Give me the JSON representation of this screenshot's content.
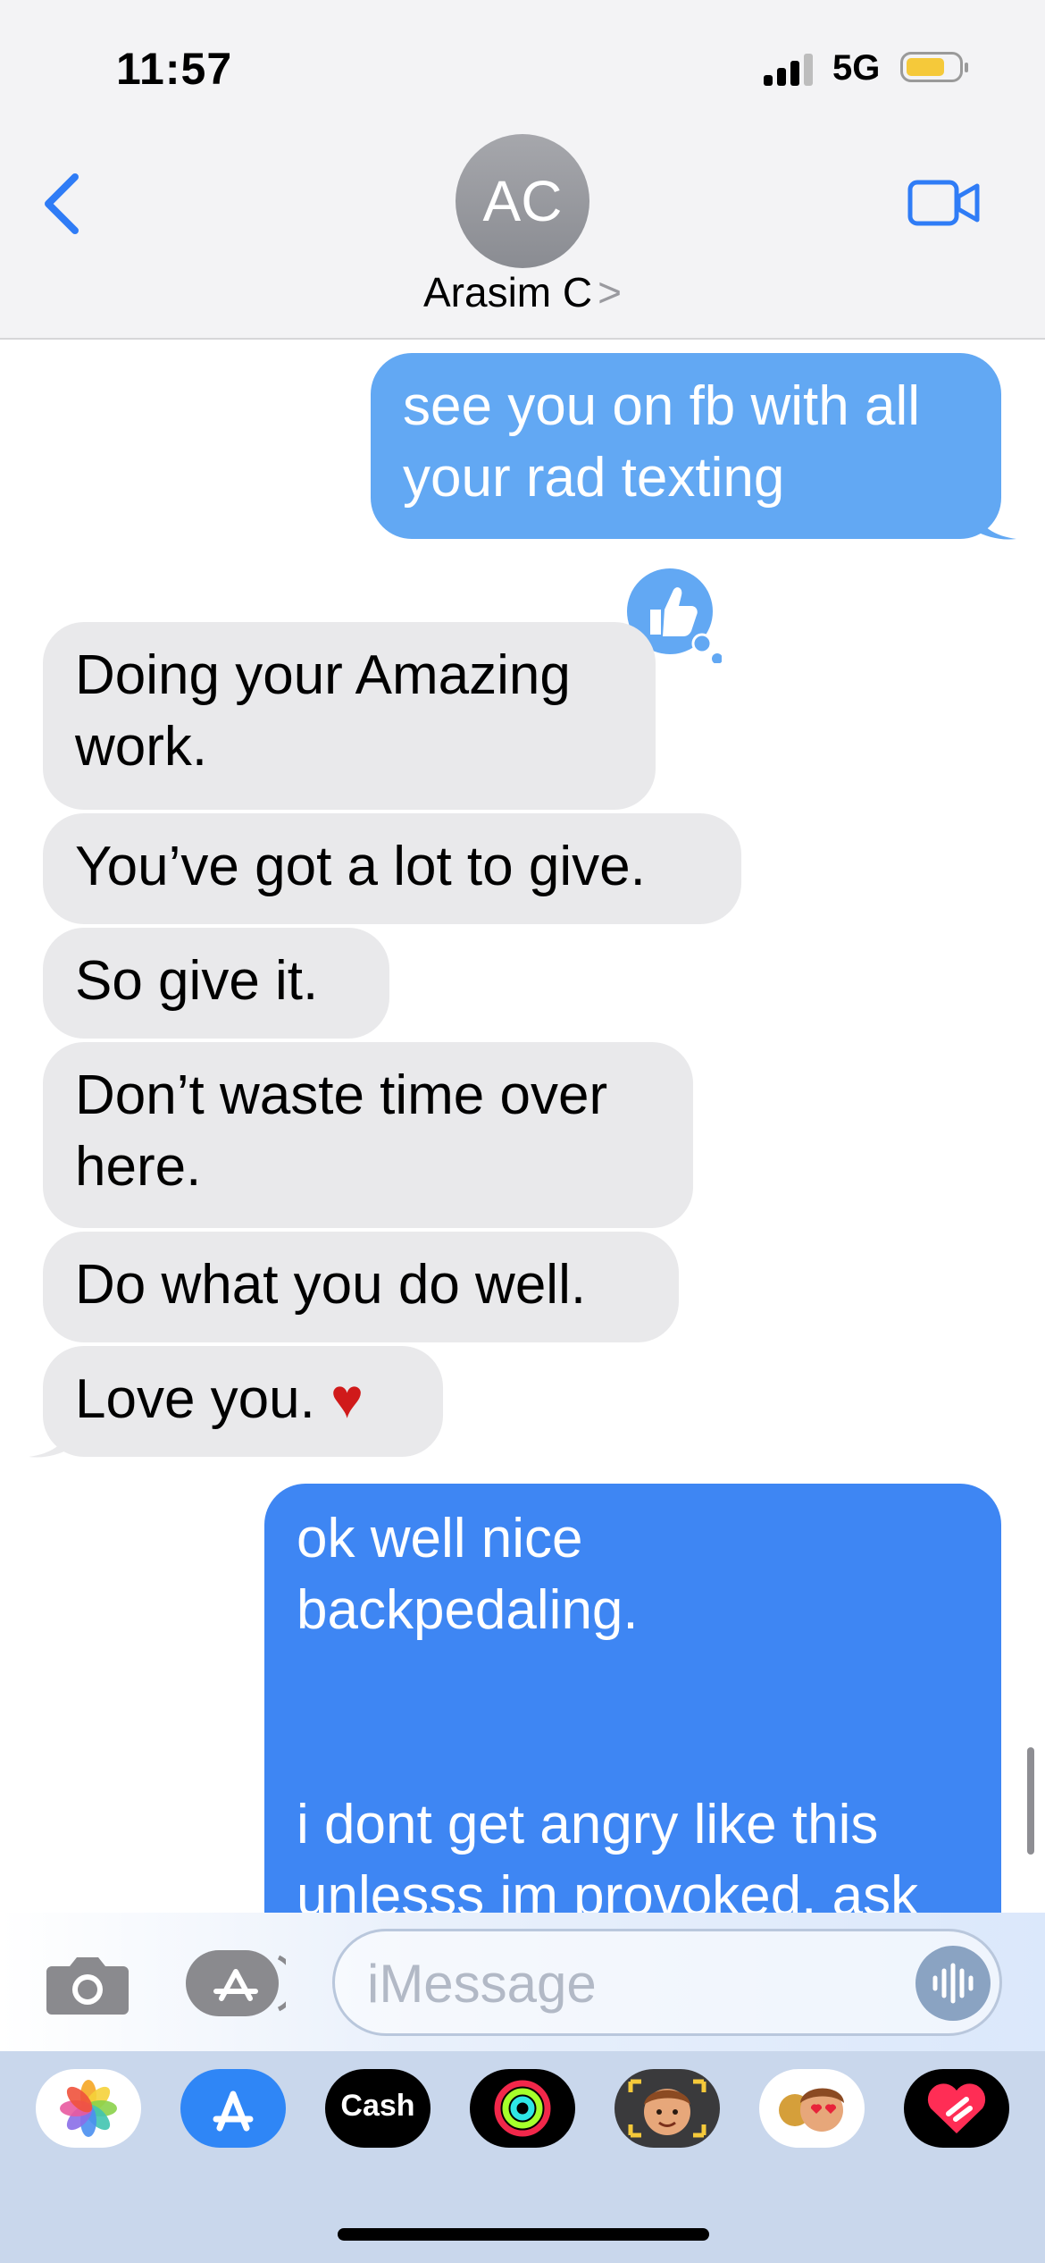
{
  "status_bar": {
    "time": "11:57",
    "network": "5G",
    "battery_color": "#f5c93a"
  },
  "header": {
    "avatar_initials": "AC",
    "contact_name": "Arasim C",
    "chevron": ">"
  },
  "messages": [
    {
      "from": "me",
      "lines": [
        "see you on fb with all",
        "your rad texting"
      ]
    },
    {
      "from": "them",
      "lines": [
        "Doing your Amazing",
        "work."
      ],
      "reaction": "thumbs-up-icon"
    },
    {
      "from": "them",
      "lines": [
        "You’ve got a lot to give."
      ]
    },
    {
      "from": "them",
      "lines": [
        "So give it."
      ]
    },
    {
      "from": "them",
      "lines": [
        "Don’t waste time over",
        "here."
      ]
    },
    {
      "from": "them",
      "lines": [
        "Do what you do well."
      ]
    },
    {
      "from": "them",
      "lines": [
        "Love you. ♥"
      ]
    },
    {
      "from": "me",
      "lines": [
        "ok well nice",
        "backpedaling.",
        "",
        "",
        "i dont get angry like this",
        "unlesss im provoked. ask"
      ]
    }
  ],
  "input": {
    "placeholder": "iMessage"
  },
  "app_drawer": [
    "photos-icon",
    "app-store-icon",
    "cash-icon",
    "activity-icon",
    "memoji-icon",
    "memoji-stickers-icon",
    "digital-touch-icon"
  ],
  "app_drawer_labels": {
    "cash": "Cash"
  },
  "colors": {
    "sent_light": "#62a8f3",
    "sent_dark": "#3e86f3",
    "received": "#e9e9eb",
    "accent": "#2f7cf6"
  }
}
